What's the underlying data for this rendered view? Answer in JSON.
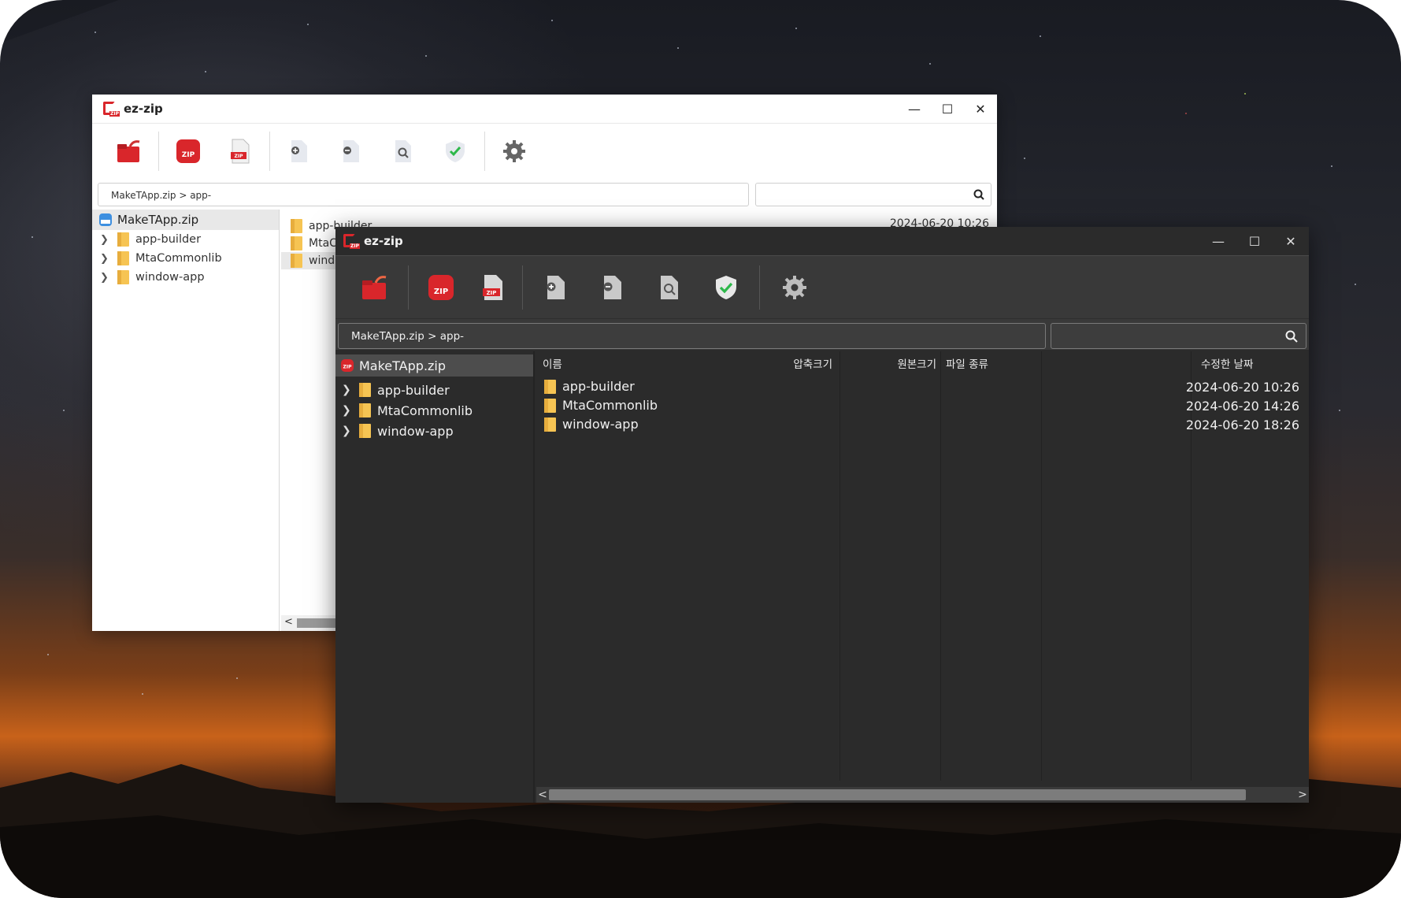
{
  "app": {
    "title": "ez-zip",
    "logo_text": "ZIP"
  },
  "window_controls": {
    "minimize": "—",
    "maximize": "☐",
    "close": "✕"
  },
  "toolbar": {
    "icons": [
      "open-icon",
      "zip-compress-icon",
      "zip-extract-icon",
      "add-file-icon",
      "remove-file-icon",
      "view-file-icon",
      "verify-icon",
      "settings-icon"
    ],
    "zip_label": "ZIP"
  },
  "address": {
    "path": "MakeTApp.zip > app-"
  },
  "tree": {
    "root": "MakeTApp.zip",
    "root_icon_text": "ZIP",
    "items": [
      {
        "label": "app-builder"
      },
      {
        "label": "MtaCommonlib"
      },
      {
        "label": "window-app"
      }
    ]
  },
  "light_window": {
    "list": [
      "app-builder",
      "MtaC",
      "windo"
    ],
    "first_date": "2024-06-20  10:26"
  },
  "columns": {
    "name": "이름",
    "compressed": "압축크기",
    "original": "원본크기",
    "type": "파일 종류",
    "modified": "수정한 날짜"
  },
  "files": [
    {
      "name": "app-builder",
      "modified": "2024-06-20  10:26"
    },
    {
      "name": "MtaCommonlib",
      "modified": "2024-06-20  14:26"
    },
    {
      "name": "window-app",
      "modified": "2024-06-20  18:26"
    }
  ],
  "scroll": {
    "left": "<",
    "right": ">"
  },
  "colors": {
    "accent": "#d9262b",
    "folder": "#f6c453",
    "verify": "#2db84a"
  }
}
